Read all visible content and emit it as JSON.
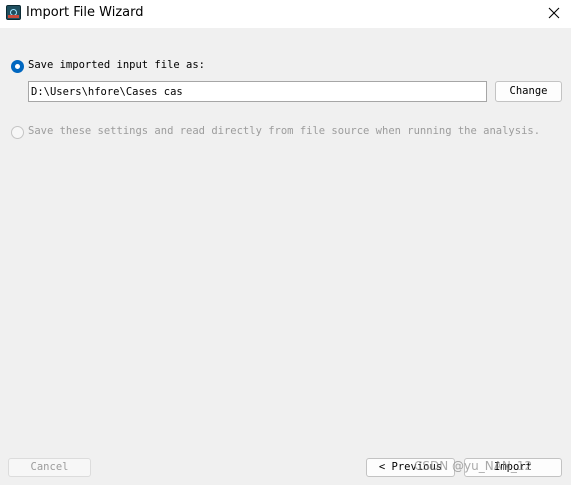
{
  "window": {
    "title": "Import File Wizard",
    "app_icon": "app-logo-icon",
    "close_icon": "close-icon"
  },
  "options": {
    "save_imported": {
      "label": "Save imported input file as:",
      "selected": true,
      "enabled": true
    },
    "path": {
      "value": "D:\\Users\\hfore\\Cases cas"
    },
    "change_label": "Change",
    "read_directly": {
      "label": "Save these settings and read directly from file source when running the analysis.",
      "selected": false,
      "enabled": false
    }
  },
  "footer": {
    "cancel_label": "Cancel",
    "previous_label": "< Previous",
    "import_label": "Import"
  },
  "overlay": {
    "watermark": "CSDN @yu_NAN_12"
  },
  "colors": {
    "accent": "#0067c0",
    "background": "#f0f0f0",
    "disabled_text": "#9c9c9c"
  }
}
